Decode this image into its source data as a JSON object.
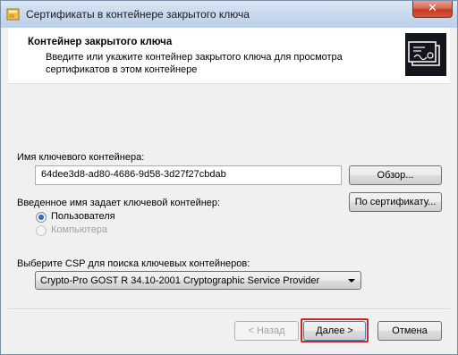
{
  "window": {
    "title": "Сертификаты в контейнере закрытого ключа",
    "close_glyph": "✕"
  },
  "header": {
    "title": "Контейнер закрытого ключа",
    "description": "Введите или укажите контейнер закрытого ключа для просмотра сертификатов в этом контейнере",
    "logo_icon": "certificate-icon"
  },
  "container": {
    "label": "Имя ключевого контейнера:",
    "value": "64dee3d8-ad80-4686-9d58-3d27f27cbdab",
    "browse_label": "Обзор..."
  },
  "key_source": {
    "label": "Введенное имя задает ключевой контейнер:",
    "by_certificate_label": "По сертификату...",
    "options": [
      {
        "label": "Пользователя",
        "checked": true,
        "enabled": true
      },
      {
        "label": "Компьютера",
        "checked": false,
        "enabled": false
      }
    ]
  },
  "csp": {
    "label": "Выберите CSP для поиска ключевых контейнеров:",
    "selected": "Crypto-Pro GOST R 34.10-2001 Cryptographic Service Provider"
  },
  "footer": {
    "back_label": "< Назад",
    "next_label": "Далее >",
    "cancel_label": "Отмена"
  },
  "colors": {
    "highlight": "#d0242f",
    "title_bar": "#c9daee"
  }
}
